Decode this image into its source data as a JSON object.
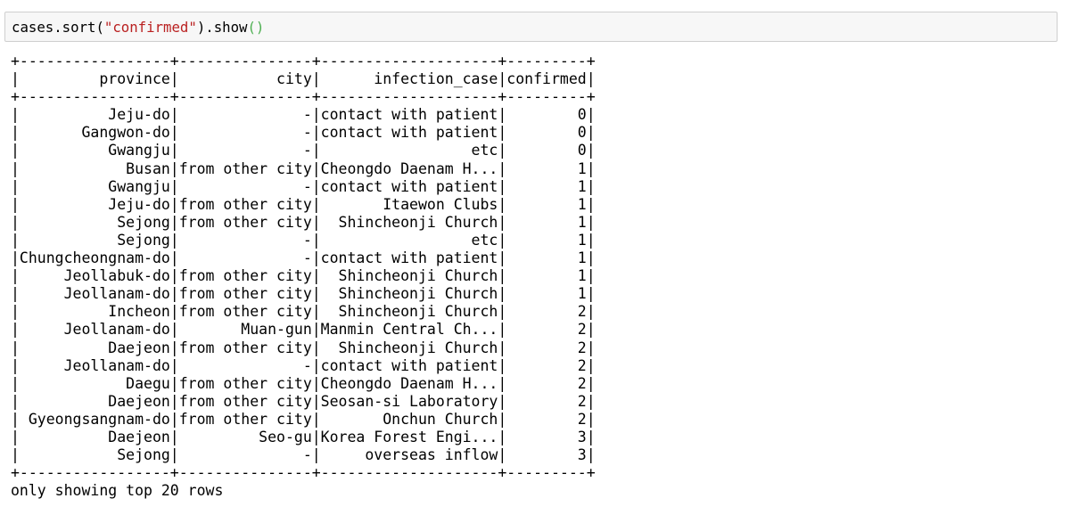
{
  "code_cell": {
    "object": "cases",
    "method_sort": ".sort(",
    "argument": "\"confirmed\"",
    "method_show": ").show",
    "call_parens": "()"
  },
  "output": {
    "border": "+-----------------+---------------+--------------------+---------+",
    "header": "|         province|           city|      infection_case|confirmed|",
    "rows": [
      "|          Jeju-do|              -|contact with patient|        0|",
      "|       Gangwon-do|              -|contact with patient|        0|",
      "|          Gwangju|              -|                 etc|        0|",
      "|            Busan|from other city|Cheongdo Daenam H...|        1|",
      "|          Gwangju|              -|contact with patient|        1|",
      "|          Jeju-do|from other city|       Itaewon Clubs|        1|",
      "|           Sejong|from other city|  Shincheonji Church|        1|",
      "|           Sejong|              -|                 etc|        1|",
      "|Chungcheongnam-do|              -|contact with patient|        1|",
      "|     Jeollabuk-do|from other city|  Shincheonji Church|        1|",
      "|     Jeollanam-do|from other city|  Shincheonji Church|        1|",
      "|          Incheon|from other city|  Shincheonji Church|        2|",
      "|     Jeollanam-do|       Muan-gun|Manmin Central Ch...|        2|",
      "|          Daejeon|from other city|  Shincheonji Church|        2|",
      "|     Jeollanam-do|              -|contact with patient|        2|",
      "|            Daegu|from other city|Cheongdo Daenam H...|        2|",
      "|          Daejeon|from other city|Seosan-si Laboratory|        2|",
      "| Gyeongsangnam-do|from other city|       Onchun Church|        2|",
      "|          Daejeon|         Seo-gu|Korea Forest Engi...|        3|",
      "|           Sejong|              -|     overseas inflow|        3|"
    ],
    "footer_note": "only showing top 20 rows"
  },
  "colors": {
    "string_literal": "#ba2121",
    "parens": "#4caf50",
    "input_background": "#f7f7f7",
    "input_border": "#cfcfcf"
  }
}
